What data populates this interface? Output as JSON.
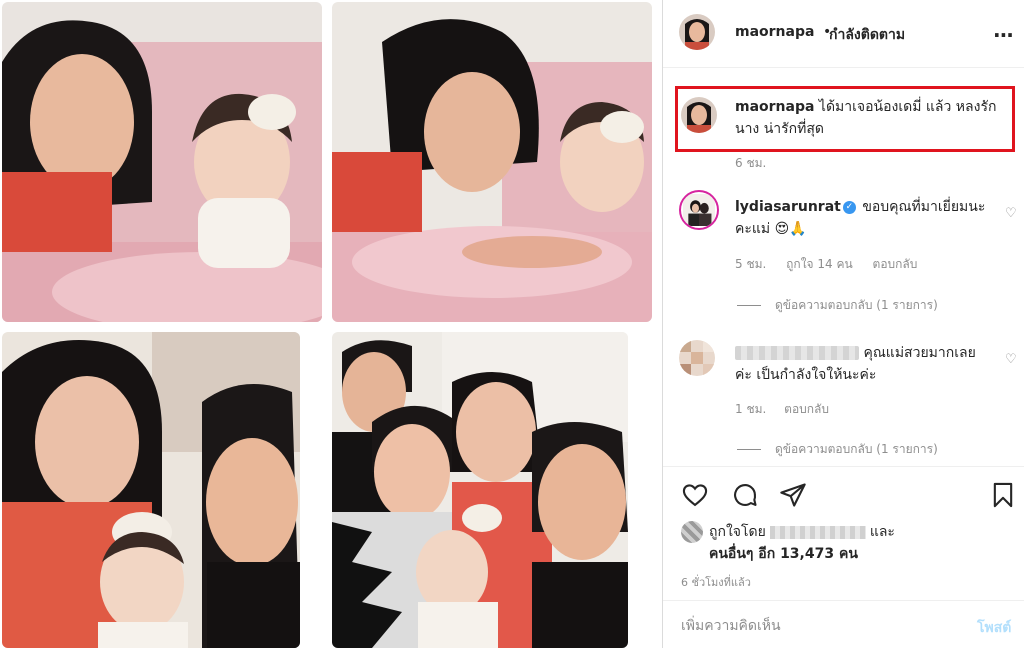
{
  "header": {
    "username": "maornapa",
    "separator": "•",
    "follow_status": "กำลังติดตาม",
    "more_label": "..."
  },
  "caption": {
    "username": "maornapa",
    "text": "ได้มาเจอน้องเดมี่ แล้ว หลงรักนาง น่ารักที่สุด",
    "time": "6 ชม."
  },
  "comments": [
    {
      "username": "lydiasarunrat",
      "verified": true,
      "text": "ขอบคุณที่มาเยี่ยมนะคะแม่ 😍🙏",
      "time": "5 ชม.",
      "likes": "ถูกใจ 14 คน",
      "reply_label": "ตอบกลับ",
      "view_replies": "ดูข้อความตอบกลับ (1 รายการ)"
    },
    {
      "username": "",
      "text": "คุณแม่สวยมากเลยค่ะ เป็นกำลังใจให้นะค่ะ",
      "time": "1 ชม.",
      "reply_label": "ตอบกลับ",
      "view_replies": "ดูข้อความตอบกลับ (1 รายการ)"
    }
  ],
  "actions": {
    "like_icon": "heart-icon",
    "comment_icon": "comment-bubble-icon",
    "share_icon": "paper-plane-icon",
    "save_icon": "bookmark-icon"
  },
  "likes": {
    "prefix": "ถูกใจโดย",
    "suffix": "และ",
    "others": "คนอื่นๆ อีก 13,473 คน"
  },
  "post_time": "6 ชั่วโมงที่แล้ว",
  "add_comment": {
    "placeholder": "เพิ่มความคิดเห็น",
    "post_label": "โพสต์"
  },
  "colors": {
    "highlight_box": "#e0141e",
    "link_blue": "#3897f0",
    "muted": "#8e8e8e",
    "post_disabled": "#b2dffc"
  }
}
